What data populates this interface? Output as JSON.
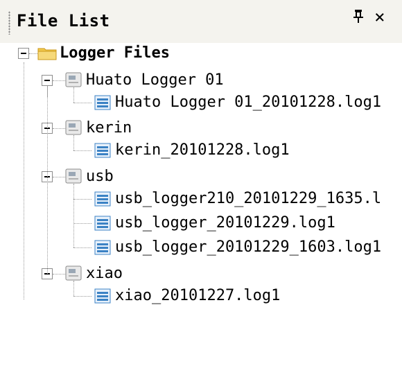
{
  "panel": {
    "title": "File List",
    "pin_glyph": "ߠ",
    "close_glyph": "×"
  },
  "tree": {
    "root": {
      "label": "Logger Files",
      "icon": "folder-icon",
      "expanded": true
    },
    "loggers": [
      {
        "label": "Huato Logger 01",
        "icon": "device-icon",
        "expanded": true,
        "files": [
          {
            "label": "Huato Logger 01_20101228.log1",
            "icon": "log-file-icon"
          }
        ]
      },
      {
        "label": "kerin",
        "icon": "device-icon",
        "expanded": true,
        "files": [
          {
            "label": "kerin_20101228.log1",
            "icon": "log-file-icon"
          }
        ]
      },
      {
        "label": "usb",
        "icon": "device-icon",
        "expanded": true,
        "files": [
          {
            "label": "usb_logger210_20101229_1635.l",
            "icon": "log-file-icon"
          },
          {
            "label": "usb_logger_20101229.log1",
            "icon": "log-file-icon"
          },
          {
            "label": "usb_logger_20101229_1603.log1",
            "icon": "log-file-icon"
          }
        ]
      },
      {
        "label": "xiao",
        "icon": "device-icon",
        "expanded": true,
        "files": [
          {
            "label": "xiao_20101227.log1",
            "icon": "log-file-icon"
          }
        ]
      }
    ]
  },
  "colors": {
    "header_bg": "#f4f3ee",
    "folder": "#f2c94c",
    "log_icon": "#3b82c4",
    "tree_lines": "#9a9a9a"
  }
}
